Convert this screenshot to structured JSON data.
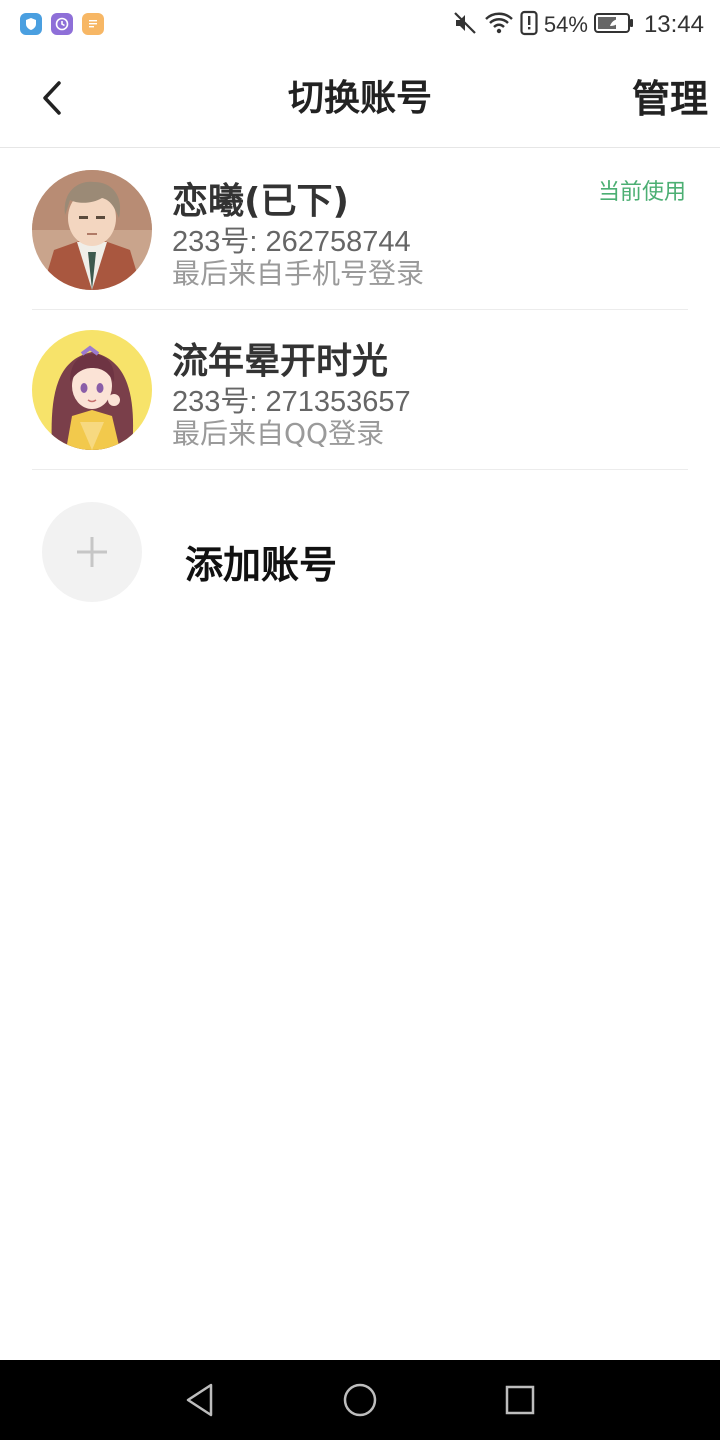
{
  "status_bar": {
    "battery": "54%",
    "time": "13:44",
    "notification_icons": [
      "shield-app-icon",
      "clock-app-icon",
      "note-app-icon"
    ],
    "system_icons": [
      "mute-icon",
      "wifi-icon",
      "alert-icon",
      "battery-icon"
    ]
  },
  "header": {
    "title": "切换账号",
    "manage_label": "管理",
    "back_icon": "chevron-left-icon"
  },
  "accounts": [
    {
      "name": "恋曦(已下)",
      "id_text": "233号: 262758744",
      "login_text": "最后来自手机号登录",
      "badge": "当前使用",
      "avatar": "anime-boy-avatar"
    },
    {
      "name": "流年晕开时光",
      "id_text": "233号: 271353657",
      "login_text": "最后来自QQ登录",
      "avatar": "anime-girl-avatar"
    }
  ],
  "add_account": {
    "label": "添加账号",
    "icon": "plus-icon"
  },
  "nav": {
    "buttons": [
      "back-triangle-icon",
      "home-circle-icon",
      "recents-square-icon"
    ]
  },
  "colors": {
    "accent_green": "#4caf73",
    "nav_bg": "#000000"
  }
}
